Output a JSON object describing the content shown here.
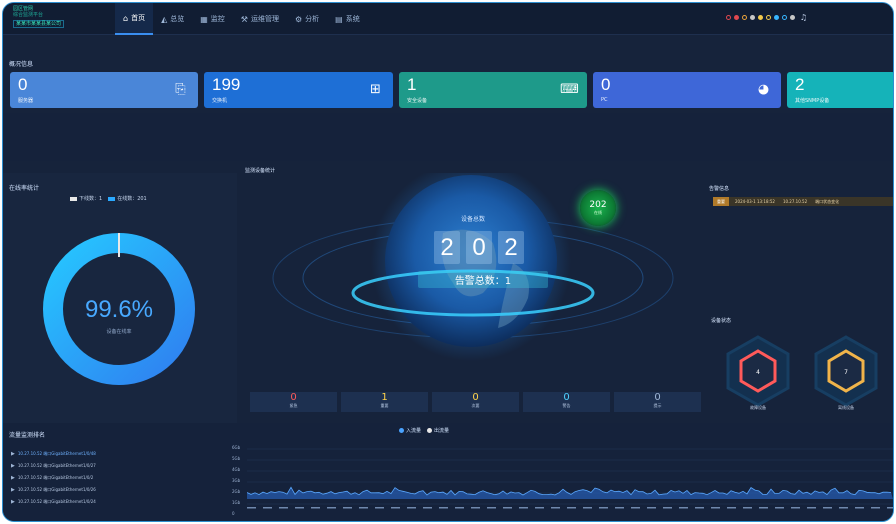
{
  "header": {
    "logo_lines": [
      "园区管网",
      "综合监测平台",
      "某某市某某县某公司"
    ],
    "nav": [
      {
        "label": "首页",
        "icon": "home-icon",
        "glyph": "⌂",
        "active": true
      },
      {
        "label": "总览",
        "icon": "chart-icon",
        "glyph": "◭"
      },
      {
        "label": "监控",
        "icon": "grid-icon",
        "glyph": "▦"
      },
      {
        "label": "运维管理",
        "icon": "wrench-icon",
        "glyph": "⚒"
      },
      {
        "label": "分析",
        "icon": "gear-icon",
        "glyph": "⚙"
      },
      {
        "label": "系统",
        "icon": "doc-icon",
        "glyph": "▤"
      }
    ],
    "status_dots": [
      "#e0484f",
      "#e0484f",
      "#e9a23b",
      "#c7c7c7",
      "#f2c94c",
      "#f2c94c",
      "#38b6ff",
      "#38b6ff",
      "#c7c7c7",
      "#d0d0d0"
    ]
  },
  "overview": {
    "title": "概况信息",
    "cards": [
      {
        "value": "0",
        "label": "服务器",
        "icon": "server-icon",
        "glyph": "⎘",
        "color": "#4a86d8"
      },
      {
        "value": "199",
        "label": "交换机",
        "icon": "switch-icon",
        "glyph": "⊞",
        "color": "#1e6fd6"
      },
      {
        "value": "1",
        "label": "安全设备",
        "icon": "keyboard-icon",
        "glyph": "⌨",
        "color": "#1e9a8a"
      },
      {
        "value": "0",
        "label": "PC",
        "icon": "globe-icon",
        "glyph": "◕",
        "color": "#3e67d8"
      },
      {
        "value": "2",
        "label": "其他SNMP设备",
        "icon": "device-icon",
        "glyph": "",
        "color": "#15b3b9"
      }
    ]
  },
  "online": {
    "title": "在线率统计",
    "legend": [
      {
        "label": "下线数：1",
        "color": "#e8e8e8"
      },
      {
        "label": "在线数：201",
        "color": "#2aa9ff"
      }
    ],
    "percent": "99.6%",
    "caption": "设备在线率"
  },
  "globe": {
    "title": "监测设备统计",
    "counter_label": "设备总数",
    "digits": [
      "2",
      "0",
      "2"
    ],
    "alarm_text": "告警总数：1",
    "badge_value": "202",
    "badge_label": "在线",
    "stats": [
      {
        "value": "0",
        "label": "紧急",
        "color": "#ff5a5a"
      },
      {
        "value": "1",
        "label": "重要",
        "color": "#ffd34a"
      },
      {
        "value": "0",
        "label": "次要",
        "color": "#ffd34a"
      },
      {
        "value": "0",
        "label": "警告",
        "color": "#4fd2ff"
      },
      {
        "value": "0",
        "label": "提示",
        "color": "#9fb6d6"
      }
    ]
  },
  "alerts": {
    "title": "告警信息",
    "strip": {
      "tag": "重要",
      "time": "2024-03-1 13:18:52",
      "ip": "10.27.10.52",
      "message": "端口状态变化"
    }
  },
  "hex": {
    "title": "设备状态",
    "items": [
      {
        "value": "4",
        "label": "故障设备",
        "color": "#ff5a5a"
      },
      {
        "value": "7",
        "label": "离线设备",
        "color": "#f0b44a"
      }
    ]
  },
  "traffic": {
    "list_title": "流量监测排名",
    "list": [
      "10.27.10.52 端口GigabitEthernet1/0/48",
      "10.27.10.52 端口GigabitEthernet1/0/27",
      "10.27.10.52 端口GigabitEthernet1/0/2",
      "10.27.10.52 端口GigabitEthernet1/0/26",
      "10.27.10.52 端口GigabitEthernet1/0/24"
    ],
    "legend": [
      {
        "label": "入流量",
        "color": "#4aa3ff"
      },
      {
        "label": "出流量",
        "color": "#e8e8e8"
      }
    ],
    "yticks": [
      "6Gb",
      "5Gb",
      "4Gb",
      "3Gb",
      "2Gb",
      "1Gb",
      "0"
    ]
  }
}
